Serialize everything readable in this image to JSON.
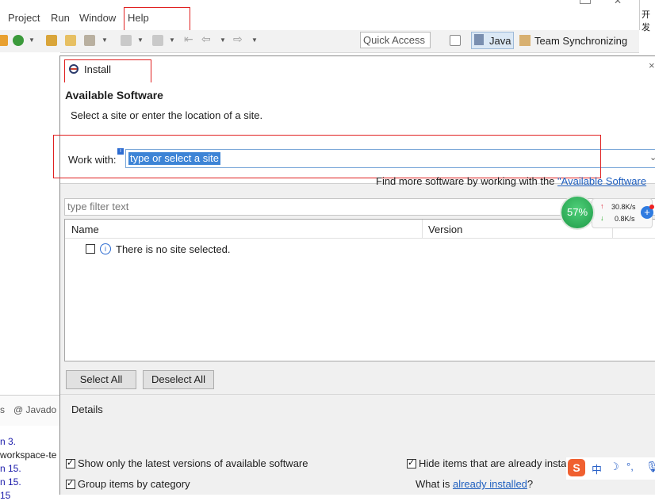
{
  "menubar": {
    "items": [
      "Project",
      "Run",
      "Window",
      "Help"
    ]
  },
  "window_right_text": "开发",
  "toolbar": {
    "quick_access": "Quick Access"
  },
  "perspectives": {
    "java": "Java",
    "team": "Team Synchronizing"
  },
  "left_panel": {
    "tab_s": "s",
    "javadoc_tab": "@ Javado",
    "log_lines": [
      "n 3.",
      "workspace-te",
      "n 15.",
      "n 15.",
      "15"
    ]
  },
  "dialog": {
    "title": "Install",
    "heading": "Available Software",
    "description": "Select a site or enter the location of a site.",
    "work_with_label": "Work with:",
    "work_with_value": "type or select a site",
    "find_more_text": "Find more software by working with the ",
    "find_more_link": "\"Available Software",
    "filter_placeholder": "type filter text",
    "table": {
      "columns": [
        "Name",
        "Version"
      ],
      "empty_message": "There is no site selected."
    },
    "select_all": "Select All",
    "deselect_all": "Deselect All",
    "details_label": "Details",
    "options": {
      "show_latest": "Show only the latest versions of available software",
      "group_by_category": "Group items by category",
      "hide_installed": "Hide items that are already insta",
      "what_is": "What is ",
      "already_installed_link": "already installed",
      "what_is_suffix": "?"
    }
  },
  "net_widget": {
    "percent": "57%",
    "upload": "30.8K/s",
    "download": "0.8K/s"
  },
  "ime": {
    "logo": "S",
    "mode": "中"
  },
  "colors": {
    "accent": "#3d84d6",
    "highlight_box": "#e02020",
    "net_green": "#1e9a46"
  }
}
